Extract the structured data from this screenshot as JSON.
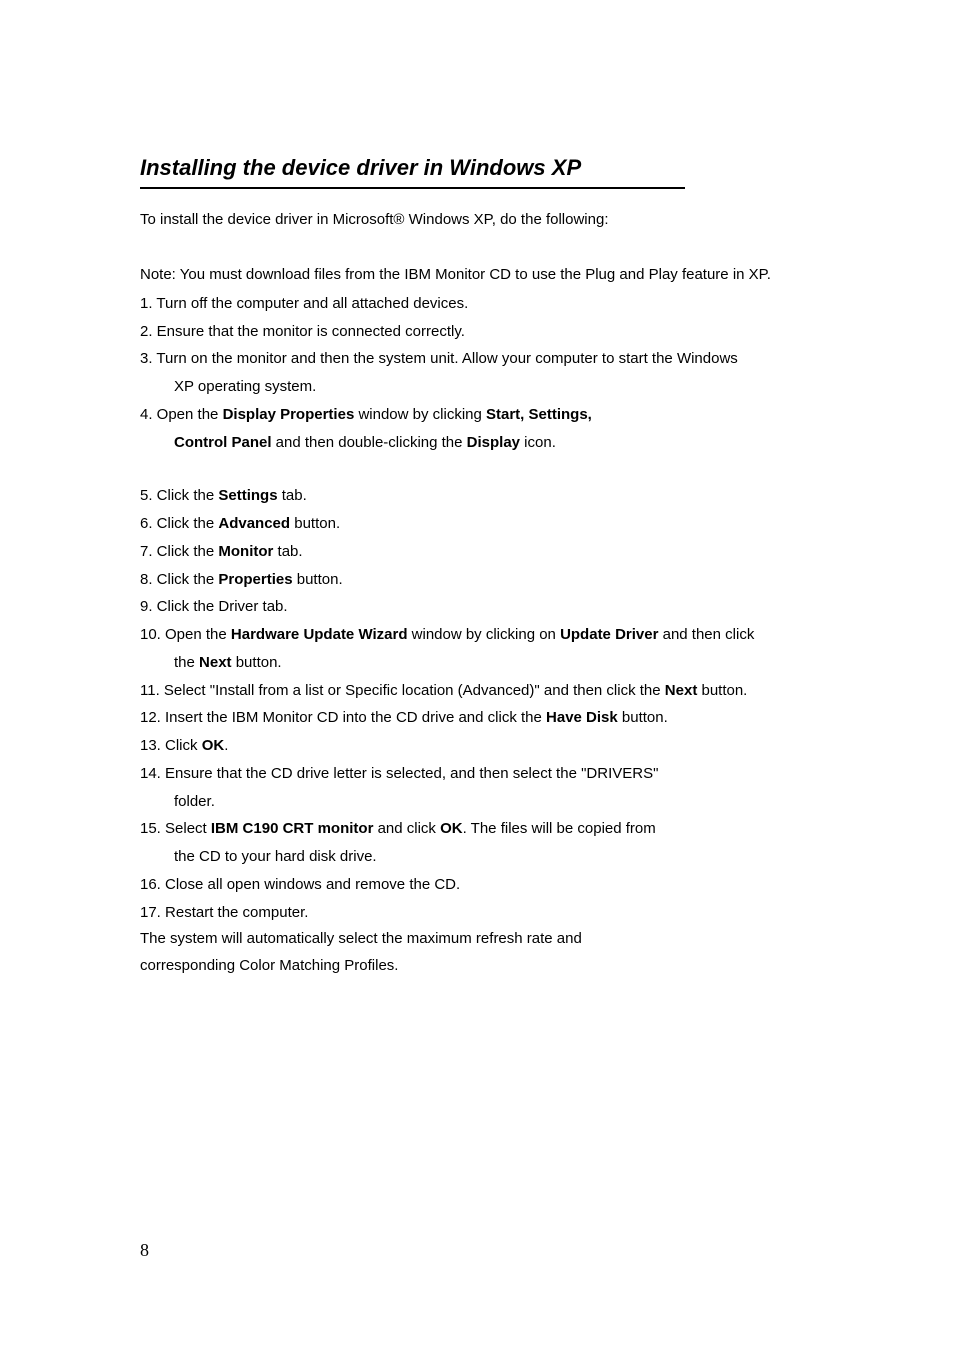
{
  "heading": "Installing the device driver in Windows XP",
  "intro": "To install the device driver in Microsoft® Windows XP, do the following:",
  "note": "Note: You must download files from the IBM Monitor CD to use the Plug and Play feature in XP.",
  "steps": {
    "s1": "1. Turn off the computer and all attached devices.",
    "s2": "2. Ensure that the monitor is connected correctly.",
    "s3a": "3. Turn on the monitor and then the system unit. Allow your computer to start the Windows",
    "s3b": "XP operating system.",
    "s4a_pre": "4. Open the ",
    "s4a_b1": "Display Properties",
    "s4a_mid": " window by clicking ",
    "s4a_b2": "Start, Settings,",
    "s4b_b1": "Control Panel",
    "s4b_mid": " and then double-clicking the ",
    "s4b_b2": "Display",
    "s4b_post": " icon.",
    "s5_pre": "5. Click the ",
    "s5_b": "Settings",
    "s5_post": " tab.",
    "s6_pre": "6. Click the ",
    "s6_b": "Advanced",
    "s6_post": " button.",
    "s7_pre": "7. Click the ",
    "s7_b": "Monitor",
    "s7_post": " tab.",
    "s8_pre": "8. Click the ",
    "s8_b": "Properties",
    "s8_post": " button.",
    "s9": "9. Click the Driver tab.",
    "s10a_pre": "10. Open the ",
    "s10a_b1": "Hardware Update Wizard",
    "s10a_mid": " window by clicking on ",
    "s10a_b2": "Update Driver",
    "s10a_post": " and then click",
    "s10b_pre": "the ",
    "s10b_b": "Next",
    "s10b_post": " button.",
    "s11_pre": "11. Select \"Install from a list or Specific location (Advanced)\" and then click the ",
    "s11_b": "Next",
    "s11_post": " button.",
    "s12_pre": "12. Insert the IBM Monitor CD into the CD drive and click the ",
    "s12_b": "Have Disk",
    "s12_post": " button.",
    "s13_pre": "13. Click ",
    "s13_b": "OK",
    "s13_post": ".",
    "s14a": "14. Ensure that the CD drive letter is selected, and then select the \"DRIVERS\"",
    "s14b": "folder.",
    "s15a_pre": "15. Select ",
    "s15a_b1": "IBM C190 CRT monitor",
    "s15a_mid": " and click ",
    "s15a_b2": "OK",
    "s15a_post": ". The files will be copied from",
    "s15b": "the CD to your hard disk drive.",
    "s16": "16. Close all open windows and remove the CD.",
    "s17": "17. Restart the computer."
  },
  "closing1": "The system will automatically select the maximum refresh rate and",
  "closing2": "corresponding Color Matching Profiles.",
  "page_number": "8"
}
